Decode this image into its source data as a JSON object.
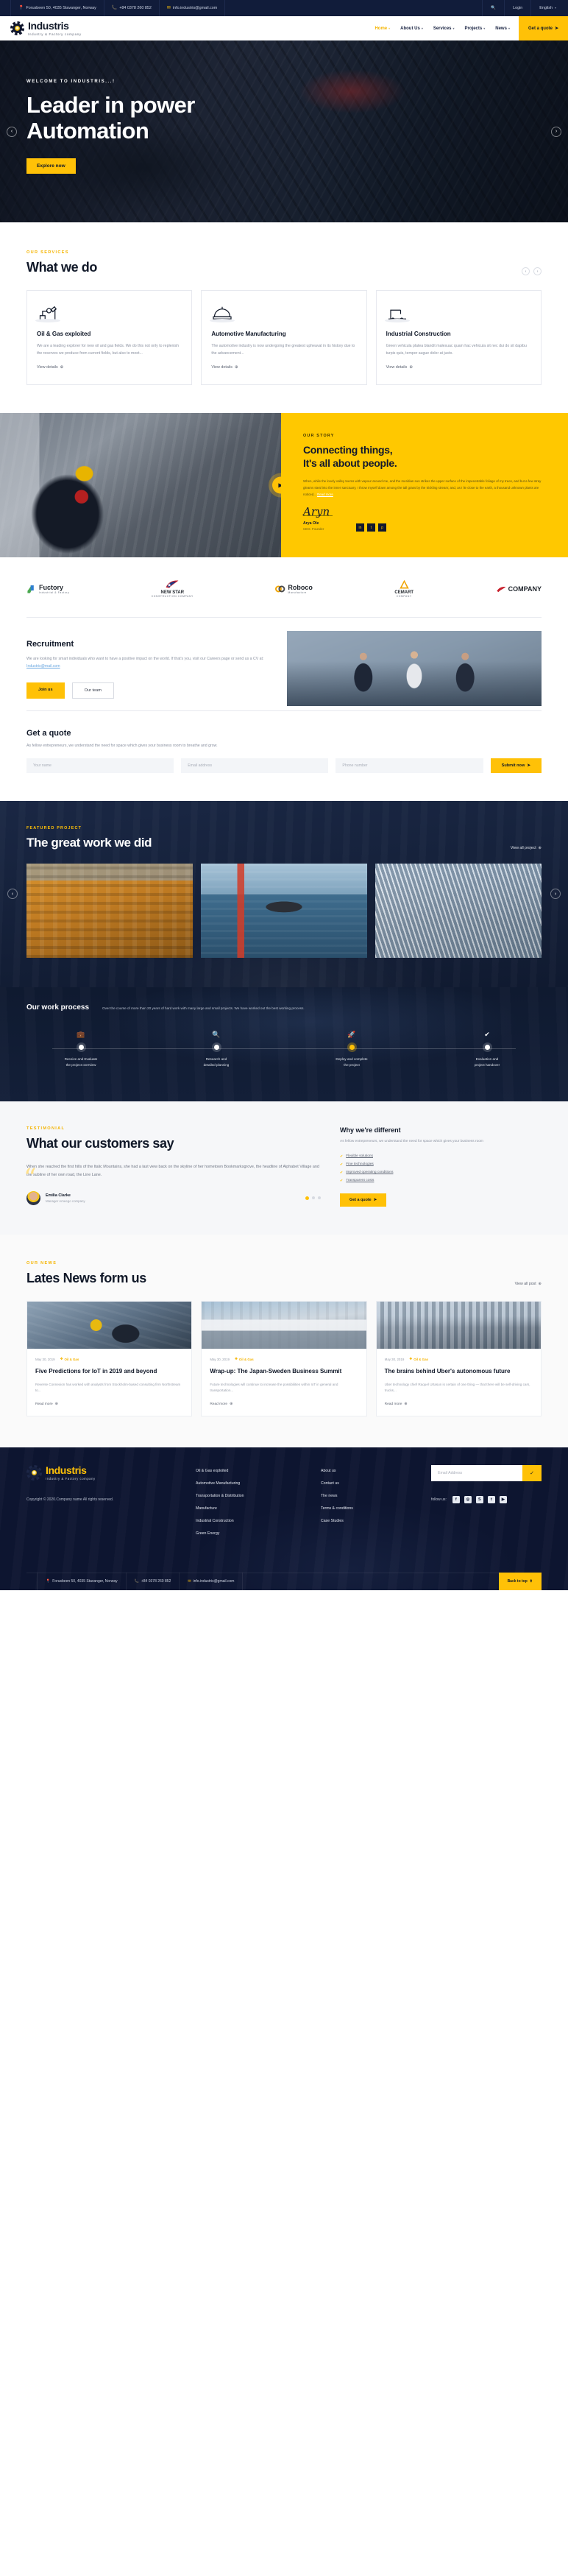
{
  "topbar": {
    "address": "Forusbeen 50, 4035 Stavanger, Norway",
    "phone": "+84 0378 260 852",
    "email": "info.industris@gmail.com",
    "login": "Login",
    "language": "English"
  },
  "brand": {
    "name": "Industris",
    "tagline": "Industry & Factory company"
  },
  "nav": {
    "items": [
      {
        "label": "Home",
        "active": true
      },
      {
        "label": "About Us",
        "active": false
      },
      {
        "label": "Services",
        "active": false
      },
      {
        "label": "Projects",
        "active": false
      },
      {
        "label": "News",
        "active": false
      }
    ],
    "cta": "Get a quote"
  },
  "hero": {
    "kicker": "WELCOME TO INDUSTRIS...!",
    "title_line1": "Leader in power",
    "title_line2": "Automation",
    "button": "Explore now"
  },
  "services": {
    "kicker": "OUR SERVICES",
    "title": "What we do",
    "cards": [
      {
        "icon": "oil-pump-icon",
        "title": "Oil & Gas exploited",
        "desc": "We are a leading explorer for new oil and gas fields. We do this not only to replenish the reserves we produce from current fields, but also to meet...",
        "link": "View details"
      },
      {
        "icon": "helmet-icon",
        "title": "Automotive Manufacturing",
        "desc": "The automotive industry is now undergoing the greatest upheaval in its history due to the advancement...",
        "link": "View details"
      },
      {
        "icon": "crane-icon",
        "title": "Industrial Construction",
        "desc": "Green vehicula platea blandit malesuac quam hac vehicula sit nec dui do sit dapibu turpis quis, tempor augue dolor at justo.",
        "link": "View details"
      }
    ]
  },
  "story": {
    "kicker": "OUR STORY",
    "title_line1": "Connecting things,",
    "title_line2": "It's all about people.",
    "paragraph": "When, while the lovely valley teems with vapour around me, and the meridian sun strikes the upper surface of the impenetrable foliage of my trees, and but a few stray gleams steal into the inner sanctuary, I throw myself down among the tall grass by the trickling stream; and, as I lie close to the earth, a thousand unknown plants are noticed...",
    "read_more": "Read more",
    "signature": "Aryn",
    "name": "Arya Ole",
    "role": "CEO. Founder",
    "socials": [
      "in",
      "f",
      "g"
    ]
  },
  "brands": [
    {
      "name": "Fuctory",
      "sub": "Industrial & Factory"
    },
    {
      "name": "NEW STAR",
      "sub": "CONSTRUCTION COMPANY"
    },
    {
      "name": "Roboco",
      "sub": "Manufacture"
    },
    {
      "name": "CEMART",
      "sub": "COMPANY"
    },
    {
      "name": "COMPANY",
      "sub": ""
    }
  ],
  "recruitment": {
    "title": "Recruitment",
    "desc_1": "We are looking for smart individuals who want to have a positive impact on the world. If that's you, visit our Careers page or send us a CV at:",
    "email": "Industris@mail.com",
    "btn_primary": "Join us",
    "btn_secondary": "Our team"
  },
  "get_quote": {
    "title": "Get a quote",
    "desc": "As fellow entrepreneurs, we understand the need for space which gives your business room to breathe and grow.",
    "name_placeholder": "Your name",
    "email_placeholder": "Email address",
    "phone_placeholder": "Phone number",
    "submit": "Submit now"
  },
  "projects": {
    "kicker": "FEATURED PROJECT",
    "title": "The great work we did",
    "view_all": "View all project",
    "items": [
      "industrial-building",
      "cargo-ship",
      "modern-facade"
    ]
  },
  "process": {
    "title": "Our work process",
    "desc": "Over the course of more than 20 years of hard work with many large and small projects. We have worked out the best working process.",
    "steps": [
      {
        "icon": "briefcase-icon",
        "label_1": "Receive and Evaluate",
        "label_2": "the project overview",
        "active": false
      },
      {
        "icon": "search-icon",
        "label_1": "Research and",
        "label_2": "detailed planning",
        "active": false
      },
      {
        "icon": "rocket-icon",
        "label_1": "Deploy and complete",
        "label_2": "the project",
        "active": true
      },
      {
        "icon": "check-icon",
        "label_1": "Evaluation and",
        "label_2": "project handover",
        "active": false
      }
    ]
  },
  "testimonials": {
    "kicker": "TESTIMONIAL",
    "title": "What our customers say",
    "quote": "When she reached the first hills of the Italic Mountains, she had a last view back on the skyline of her hometown Bookmarksgrove, the headline of Alphabet Village and the subline of her own road, the Line Lane.",
    "author_name": "Emilia Clarke",
    "author_role": "Manager Ameego company",
    "dots": 3,
    "right_title": "Why we're different",
    "right_desc": "As fellow entrepreneurs, we understand the need for space which gives your business room",
    "right_list": [
      "Flexible solutions",
      "Fine technologies",
      "Improved operating conditions",
      "Transparent costs"
    ],
    "right_btn": "Get a quote"
  },
  "news": {
    "kicker": "OUR NEWS",
    "title": "Lates News form us",
    "view_all": "View all post",
    "items": [
      {
        "date": "May 30, 2019",
        "category": "Oil & Gas",
        "title": "Five Predictions for IoT in 2019 and beyond",
        "excerpt": "Reverse Connexion has worked with analysts from Stockholm-based consulting firm Northstream to...",
        "link": "Read more"
      },
      {
        "date": "May 30, 2019",
        "category": "Oil & Gas",
        "title": "Wrap-up: The Japan-Sweden Business Summit",
        "excerpt": "Future technologies will continue to increase the possibilities within IoT in general and transportation...",
        "link": "Read more"
      },
      {
        "date": "May 30, 2019",
        "category": "Oil & Gas",
        "title": "The brains behind Uber's autonomous future",
        "excerpt": "Uber technology chief Raquel Urtasun is certain of one thing — that there will be self-driving cars, trucks...",
        "link": "Read more"
      }
    ]
  },
  "footer": {
    "copyright": "Copyright © 2020.Company name All rights reserved.",
    "col_services": [
      "Oil & Gas exploited",
      "Automotive Manufacturing",
      "Transportation & Distribution",
      "Manufacture",
      "Industrial Construction",
      "Green Energy"
    ],
    "col_company": [
      "About us",
      "Contact us",
      "The news",
      "Terms & conditions",
      "Case Studies"
    ],
    "newsletter_placeholder": "Email Address",
    "follow_label": "follow us:",
    "socials": [
      "f",
      "◉",
      "S",
      "t",
      "▶"
    ],
    "bottom_address": "Forusbeen 50, 4035 Stavanger, Norway",
    "bottom_phone": "+84 0378 260 852",
    "bottom_email": "info.industris@gmail.com",
    "back_to_top": "Back to top"
  },
  "colors": {
    "accent": "#ffc107",
    "dark": "#0d1530",
    "navy": "#111c3a",
    "muted": "#8a91a0"
  }
}
